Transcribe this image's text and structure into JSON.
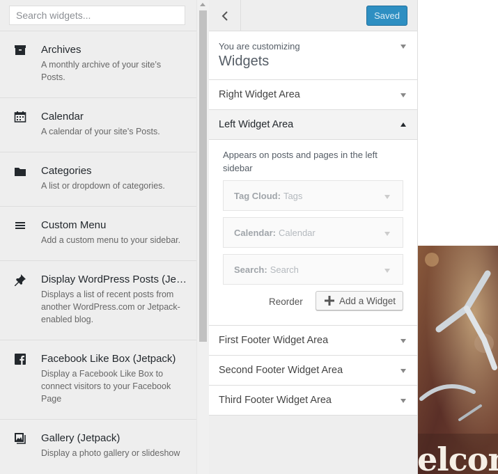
{
  "search": {
    "placeholder": "Search widgets..."
  },
  "widgets": [
    {
      "title": "Archives",
      "description": "A monthly archive of your site’s Posts.",
      "icon": "archive-icon"
    },
    {
      "title": "Calendar",
      "description": "A calendar of your site’s Posts.",
      "icon": "calendar-icon"
    },
    {
      "title": "Categories",
      "description": "A list or dropdown of categories.",
      "icon": "folder-icon"
    },
    {
      "title": "Custom Menu",
      "description": "Add a custom menu to your sidebar.",
      "icon": "menu-icon"
    },
    {
      "title": "Display WordPress Posts (Jet...",
      "description": "Displays a list of recent posts from another WordPress.com or Jetpack-enabled blog.",
      "icon": "pin-icon"
    },
    {
      "title": "Facebook Like Box (Jetpack)",
      "description": "Display a Facebook Like Box to connect visitors to your Facebook Page",
      "icon": "facebook-icon"
    },
    {
      "title": "Gallery (Jetpack)",
      "description": "Display a photo gallery or slideshow",
      "icon": "gallery-icon"
    }
  ],
  "customizer": {
    "saved_label": "Saved",
    "customizing_label": "You are customizing",
    "section_title": "Widgets",
    "areas": [
      "Right Widget Area",
      "Left Widget Area",
      "First Footer Widget Area",
      "Second Footer Widget Area",
      "Third Footer Widget Area"
    ],
    "left_area": {
      "description": "Appears on posts and pages in the left sidebar",
      "widgets": [
        {
          "type": "Tag Cloud",
          "title": "Tags"
        },
        {
          "type": "Calendar",
          "title": "Calendar"
        },
        {
          "type": "Search",
          "title": "Search"
        }
      ],
      "reorder_label": "Reorder",
      "add_widget_label": "Add a Widget"
    }
  },
  "preview": {
    "title_fragment": "elcon"
  },
  "colors": {
    "primary": "#2e8fc2",
    "panel_bg": "#eeeeee"
  }
}
